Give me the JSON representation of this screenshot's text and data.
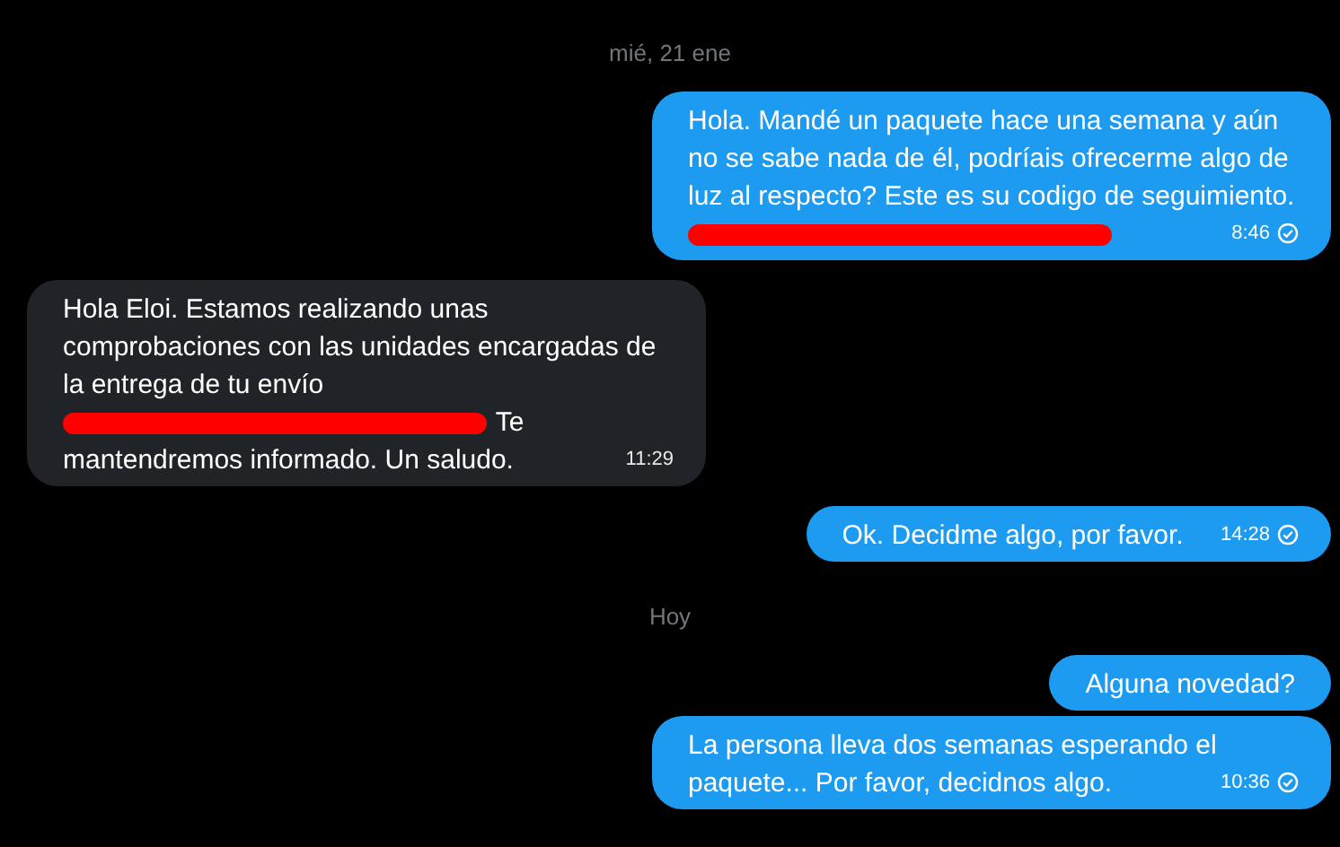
{
  "conversation": [
    {
      "kind": "date",
      "text": "mié, 21 ene"
    },
    {
      "kind": "outgoing",
      "parts": [
        {
          "kind": "text",
          "text": "Hola. Mandé un paquete hace una semana y aún no se sabe nada de él, podríais ofrecerme algo de luz al respecto? Este es su codigo de seguimiento."
        },
        {
          "kind": "redaction"
        }
      ],
      "time": "8:46",
      "sent": true
    },
    {
      "kind": "incoming",
      "parts": [
        {
          "kind": "text",
          "text": "Hola Eloi. Estamos realizando unas comprobaciones con las unidades encargadas de la entrega de tu envío"
        },
        {
          "kind": "redaction"
        },
        {
          "kind": "text",
          "text": "Te"
        },
        {
          "kind": "text",
          "text": "mantendremos informado. Un saludo."
        }
      ],
      "time": "11:29",
      "sent": false
    },
    {
      "kind": "outgoing",
      "parts": [
        {
          "kind": "text",
          "text": "Ok. Decidme algo, por favor."
        }
      ],
      "time": "14:28",
      "sent": true
    },
    {
      "kind": "date",
      "text": "Hoy"
    },
    {
      "kind": "outgoing",
      "parts": [
        {
          "kind": "text",
          "text": "Alguna novedad?"
        }
      ],
      "sent": false
    },
    {
      "kind": "outgoing",
      "parts": [
        {
          "kind": "text",
          "text": "La persona lleva dos semanas esperando el paquete... Por favor, decidnos algo."
        }
      ],
      "time": "10:36",
      "sent": true
    }
  ]
}
